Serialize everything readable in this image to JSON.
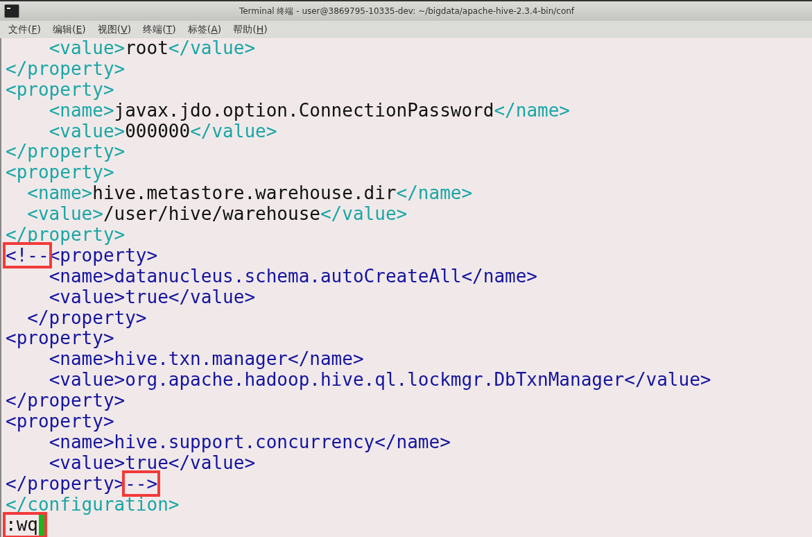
{
  "window": {
    "title": "Terminal 终端 - user@3869795-10335-dev: ~/bigdata/apache-hive-2.3.4-bin/conf"
  },
  "menu": [
    {
      "label": "文件(F)"
    },
    {
      "label": "编辑(E)"
    },
    {
      "label": "视图(V)"
    },
    {
      "label": "终端(T)"
    },
    {
      "label": "标签(A)"
    },
    {
      "label": "帮助(H)"
    }
  ],
  "editor": {
    "lines": [
      [
        {
          "kind": "tag",
          "text": "    <value>"
        },
        {
          "kind": "text",
          "text": "root"
        },
        {
          "kind": "tag",
          "text": "</value>"
        }
      ],
      [
        {
          "kind": "tag",
          "text": "</property>"
        }
      ],
      [
        {
          "kind": "tag",
          "text": "<property>"
        }
      ],
      [
        {
          "kind": "tag",
          "text": "    <name>"
        },
        {
          "kind": "text",
          "text": "javax.jdo.option.ConnectionPassword"
        },
        {
          "kind": "tag",
          "text": "</name>"
        }
      ],
      [
        {
          "kind": "tag",
          "text": "    <value>"
        },
        {
          "kind": "text",
          "text": "000000"
        },
        {
          "kind": "tag",
          "text": "</value>"
        }
      ],
      [
        {
          "kind": "tag",
          "text": "</property>"
        }
      ],
      [
        {
          "kind": "tag",
          "text": "<property>"
        }
      ],
      [
        {
          "kind": "tag",
          "text": "  <name>"
        },
        {
          "kind": "text",
          "text": "hive.metastore.warehouse.dir"
        },
        {
          "kind": "tag",
          "text": "</name>"
        }
      ],
      [
        {
          "kind": "tag",
          "text": "  <value>"
        },
        {
          "kind": "text",
          "text": "/user/hive/warehouse"
        },
        {
          "kind": "tag",
          "text": "</value>"
        }
      ],
      [
        {
          "kind": "tag",
          "text": "</property>"
        }
      ],
      [
        {
          "kind": "comment",
          "text": "<!--",
          "highlighted": true
        },
        {
          "kind": "comment",
          "text": "<property>"
        }
      ],
      [
        {
          "kind": "comment",
          "text": "    <name>datanucleus.schema.autoCreateAll</name>"
        }
      ],
      [
        {
          "kind": "comment",
          "text": "    <value>true</value>"
        }
      ],
      [
        {
          "kind": "comment",
          "text": "  </property>"
        }
      ],
      [
        {
          "kind": "comment",
          "text": "<property>"
        }
      ],
      [
        {
          "kind": "comment",
          "text": "    <name>hive.txn.manager</name>"
        }
      ],
      [
        {
          "kind": "comment",
          "text": "    <value>org.apache.hadoop.hive.ql.lockmgr.DbTxnManager</value>"
        }
      ],
      [
        {
          "kind": "comment",
          "text": "</property>"
        }
      ],
      [
        {
          "kind": "comment",
          "text": "<property>"
        }
      ],
      [
        {
          "kind": "comment",
          "text": "    <name>hive.support.concurrency</name>"
        }
      ],
      [
        {
          "kind": "comment",
          "text": "    <value>true</value>"
        }
      ],
      [
        {
          "kind": "comment",
          "text": "</property>"
        },
        {
          "kind": "comment",
          "text": "-->",
          "highlighted": true
        }
      ],
      [
        {
          "kind": "tag",
          "text": "</configuration>"
        }
      ]
    ],
    "command": {
      "text": ":wq",
      "highlighted": true
    }
  }
}
